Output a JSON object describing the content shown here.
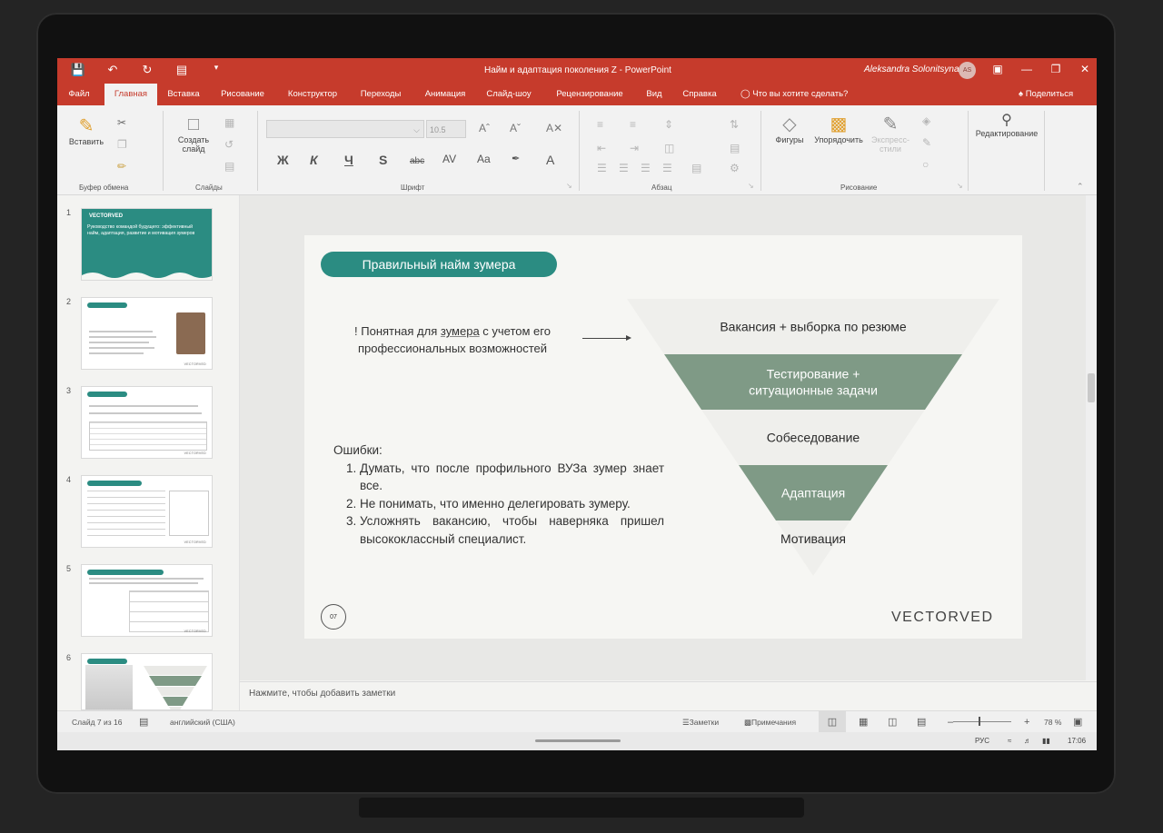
{
  "titlebar": {
    "title": "Найм и адаптация поколения Z  -  PowerPoint",
    "user": "Aleksandra Solonitsyna",
    "avatar_initials": "AS"
  },
  "tabs": [
    "Файл",
    "Главная",
    "Вставка",
    "Рисование",
    "Конструктор",
    "Переходы",
    "Анимация",
    "Слайд-шоу",
    "Рецензирование",
    "Вид",
    "Справка"
  ],
  "active_tab": "Главная",
  "tell_me": "Что вы хотите сделать?",
  "share": "Поделиться",
  "ribbon": {
    "paste_label": "Вставить",
    "new_slide_label": "Создать слайд",
    "font_size": "10.5",
    "groups": {
      "clipboard": "Буфер обмена",
      "slides": "Слайды",
      "font": "Шрифт",
      "paragraph": "Абзац",
      "drawing": "Рисование"
    },
    "shapes_label": "Фигуры",
    "arrange_label": "Упорядочить",
    "styles_label": "Экспресс-стили",
    "editing_label": "Редактирование",
    "fmt": {
      "bold": "Ж",
      "italic": "К",
      "underline": "Ч",
      "shadow": "S",
      "strike": "abc",
      "spacing": "AV",
      "case": "Aa",
      "color": "A"
    }
  },
  "thumbnails": {
    "numbers": [
      "1",
      "2",
      "3",
      "4",
      "5",
      "6"
    ],
    "slide1_logo": "VECTORVED",
    "slide1_text": "Руководство командой будущего: эффективный найм, адаптация, развитие и мотивация зумеров"
  },
  "slide": {
    "heading": "Правильный найм зумера",
    "note_prefix": "! Понятная для ",
    "note_underlined": "зумера",
    "note_suffix": " с учетом его профессиональных возможностей",
    "errors_title": "Ошибки:",
    "errors": [
      "Думать, что после профильного ВУЗа зумер знает все.",
      "Не понимать, что именно делегировать зумеру.",
      "Усложнять вакансию, чтобы наверняка пришел высококлассный специалист."
    ],
    "number": "07",
    "logo": "VECTORVED"
  },
  "chart_data": {
    "type": "funnel",
    "stages": [
      {
        "label": "Вакансия + выборка по резюме",
        "color": "#efefec"
      },
      {
        "label": "Тестирование + ситуационные задачи",
        "color": "#7f9a86"
      },
      {
        "label": "Собеседование",
        "color": "#efefec"
      },
      {
        "label": "Адаптация",
        "color": "#7f9a86"
      },
      {
        "label": "Мотивация",
        "color": "#efefec"
      }
    ]
  },
  "notes_placeholder": "Нажмите, чтобы добавить заметки",
  "status": {
    "slide": "Слайд 7 из 16",
    "language": "английский (США)",
    "notes": "Заметки",
    "comments": "Примечания",
    "zoom": "78 %"
  },
  "taskbar": {
    "lang": "РУС",
    "time": "17:06"
  },
  "colors": {
    "accent": "#c63b2c",
    "teal": "#2b8c82",
    "funnel_dark": "#7f9a86"
  }
}
